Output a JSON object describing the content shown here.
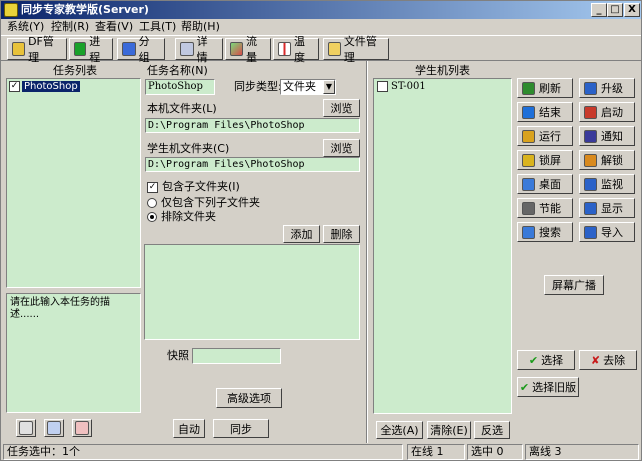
{
  "title": "同步专家教学版(Server)",
  "window_controls": {
    "min": "_",
    "max": "□",
    "close": "X"
  },
  "menu": [
    "系统(Y)",
    "控制(R)",
    "查看(V)",
    "工具(T)",
    "帮助(H)"
  ],
  "toolbar": [
    {
      "label": "DF管理",
      "icon": "key-icon"
    },
    {
      "label": "进程",
      "icon": "process-icon"
    },
    {
      "label": "分组",
      "icon": "group-icon"
    },
    {
      "label": "详情",
      "icon": "detail-icon"
    },
    {
      "label": "流量",
      "icon": "chart-icon"
    },
    {
      "label": "温度",
      "icon": "thermometer-icon"
    },
    {
      "label": "文件管理",
      "icon": "folder-icon"
    }
  ],
  "task_list": {
    "header": "任务列表",
    "items": [
      {
        "name": "PhotoShop",
        "checked": true
      }
    ]
  },
  "task_desc": "请在此输入本任务的描述......",
  "task_form": {
    "name_label": "任务名称(N)",
    "name_value": "PhotoShop",
    "sync_type_label": "同步类型:",
    "sync_type_value": "文件夹",
    "local_label": "本机文件夹(L)",
    "local_value": "D:\\Program Files\\PhotoShop",
    "browse": "浏览",
    "student_label": "学生机文件夹(C)",
    "student_value": "D:\\Program Files\\PhotoShop",
    "include_sub": "包含子文件夹(I)",
    "only_include": "仅包含下列子文件夹",
    "exclude": "排除文件夹",
    "add": "添加",
    "delete": "删除",
    "snapshot_label": "快照",
    "snapshot_value": "",
    "advanced": "高级选项",
    "auto": "自动",
    "sync": "同步"
  },
  "student_list": {
    "header": "学生机列表",
    "items": [
      {
        "name": "ST-001",
        "checked": false
      }
    ]
  },
  "student_buttons": [
    {
      "label": "刷新",
      "icon": "refresh-icon",
      "color": "#2e8b2e"
    },
    {
      "label": "升级",
      "icon": "upgrade-icon",
      "color": "#2b62c8"
    },
    {
      "label": "结束",
      "icon": "end-icon",
      "color": "#1e6fd9"
    },
    {
      "label": "启动",
      "icon": "start-icon",
      "color": "#c83a2b"
    },
    {
      "label": "运行",
      "icon": "run-icon",
      "color": "#d9a21e"
    },
    {
      "label": "通知",
      "icon": "speaker-icon",
      "color": "#3a3a9a"
    },
    {
      "label": "锁屏",
      "icon": "lock-icon",
      "color": "#d9b31e"
    },
    {
      "label": "解锁",
      "icon": "unlock-icon",
      "color": "#d98a1e"
    },
    {
      "label": "桌面",
      "icon": "desktop-icon",
      "color": "#3a7ad9"
    },
    {
      "label": "监视",
      "icon": "monitor-icon",
      "color": "#2b62c8"
    },
    {
      "label": "节能",
      "icon": "power-icon",
      "color": "#666666"
    },
    {
      "label": "显示",
      "icon": "display-icon",
      "color": "#2b62c8"
    },
    {
      "label": "搜索",
      "icon": "search-icon",
      "color": "#3a7ad9"
    },
    {
      "label": "导入",
      "icon": "import-icon",
      "color": "#2b62c8"
    }
  ],
  "broadcast": "屏幕广播",
  "select": "选择",
  "remove": "去除",
  "select_old": "选择旧版",
  "select_all": "全选(A)",
  "clear": "清除(E)",
  "invert": "反选",
  "status": {
    "task_selected": "任务选中：1个",
    "online": "在线 1",
    "selected": "选中 0",
    "offline": "离线 3"
  }
}
